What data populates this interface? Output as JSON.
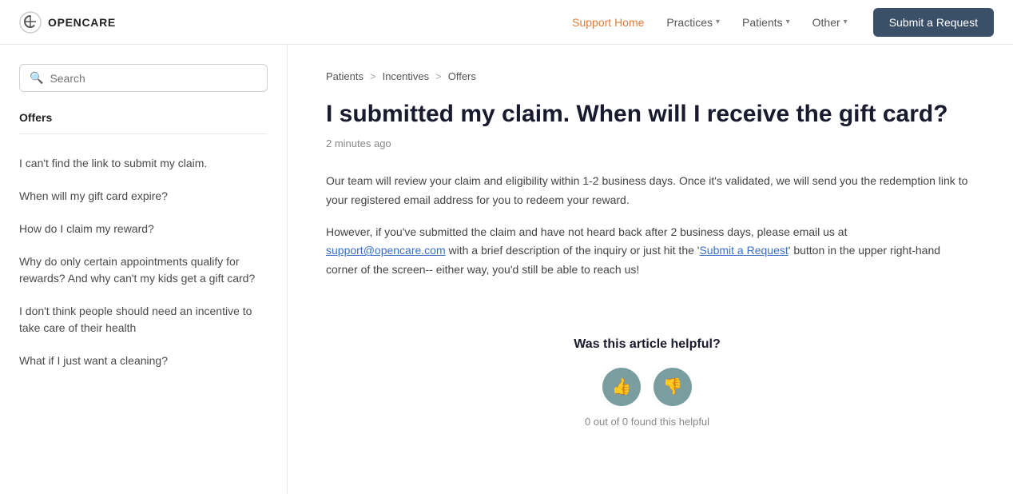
{
  "header": {
    "logo_text": "OPENCARE",
    "nav_items": [
      {
        "label": "Support Home",
        "active": true
      },
      {
        "label": "Practices",
        "has_dropdown": true
      },
      {
        "label": "Patients",
        "has_dropdown": true
      },
      {
        "label": "Other",
        "has_dropdown": true
      }
    ],
    "submit_button_label": "Submit a Request"
  },
  "sidebar": {
    "search_placeholder": "Search",
    "section_title": "Offers",
    "links": [
      {
        "label": "I can't find the link to submit my claim."
      },
      {
        "label": "When will my gift card expire?"
      },
      {
        "label": "How do I claim my reward?"
      },
      {
        "label": "Why do only certain appointments qualify for rewards? And why can't my kids get a gift card?"
      },
      {
        "label": "I don't think people should need an incentive to take care of their health"
      },
      {
        "label": "What if I just want a cleaning?"
      }
    ]
  },
  "breadcrumb": {
    "items": [
      {
        "label": "Patients"
      },
      {
        "label": "Incentives"
      },
      {
        "label": "Offers"
      }
    ]
  },
  "article": {
    "title": "I submitted my claim. When will I receive the gift card?",
    "meta": "2 minutes ago",
    "paragraphs": [
      "Our team will review your claim and eligibility within 1-2 business days.  Once it's validated, we will send you the redemption link to your registered email address for you to redeem your reward.",
      "However, if you've submitted the claim and have not heard back after 2 business days, please email us at [support@opencare.com] with a brief description of the inquiry or just hit the '[Submit a Request]' button in the upper right-hand corner of the screen-- either way, you'd still be able to reach us!"
    ],
    "support_email": "support@opencare.com",
    "submit_link_text": "Submit a Request"
  },
  "helpful": {
    "label": "Was this article helpful?",
    "thumbs_up": "👍",
    "thumbs_down": "👎",
    "count_text": "0 out of 0 found this helpful"
  }
}
